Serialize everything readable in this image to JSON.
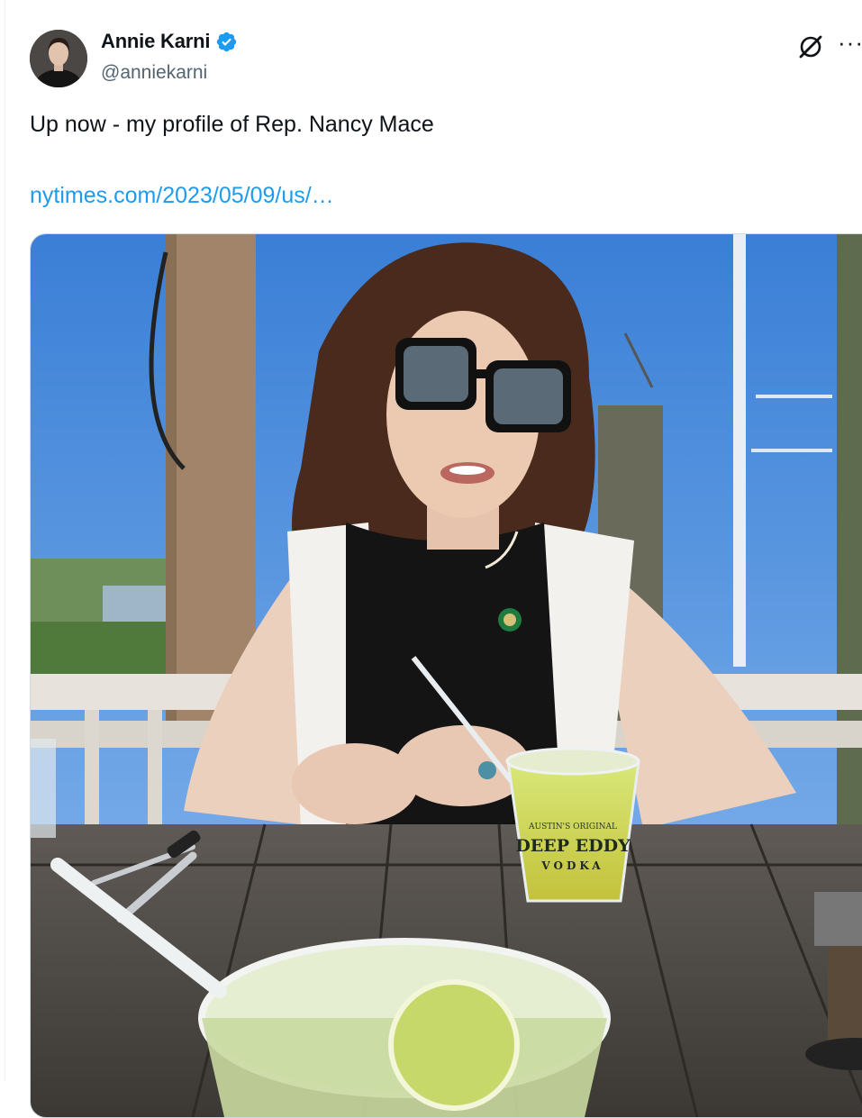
{
  "tweet": {
    "author": {
      "display_name": "Annie Karni",
      "handle": "@anniekarni",
      "verified": true,
      "verified_color": "#1d9bf0"
    },
    "text": "Up now - my profile of Rep. Nancy Mace",
    "link": "nytimes.com/2023/05/09/us/…",
    "link_color": "#1d9bf0",
    "actions": {
      "grok_icon": "grok-slash-icon",
      "more_label": "···"
    },
    "media": {
      "cup_text_small": "AUSTIN'S ORIGINAL",
      "cup_text_brand": "DEEP EDDY",
      "cup_text_sub": "VODKA"
    }
  }
}
